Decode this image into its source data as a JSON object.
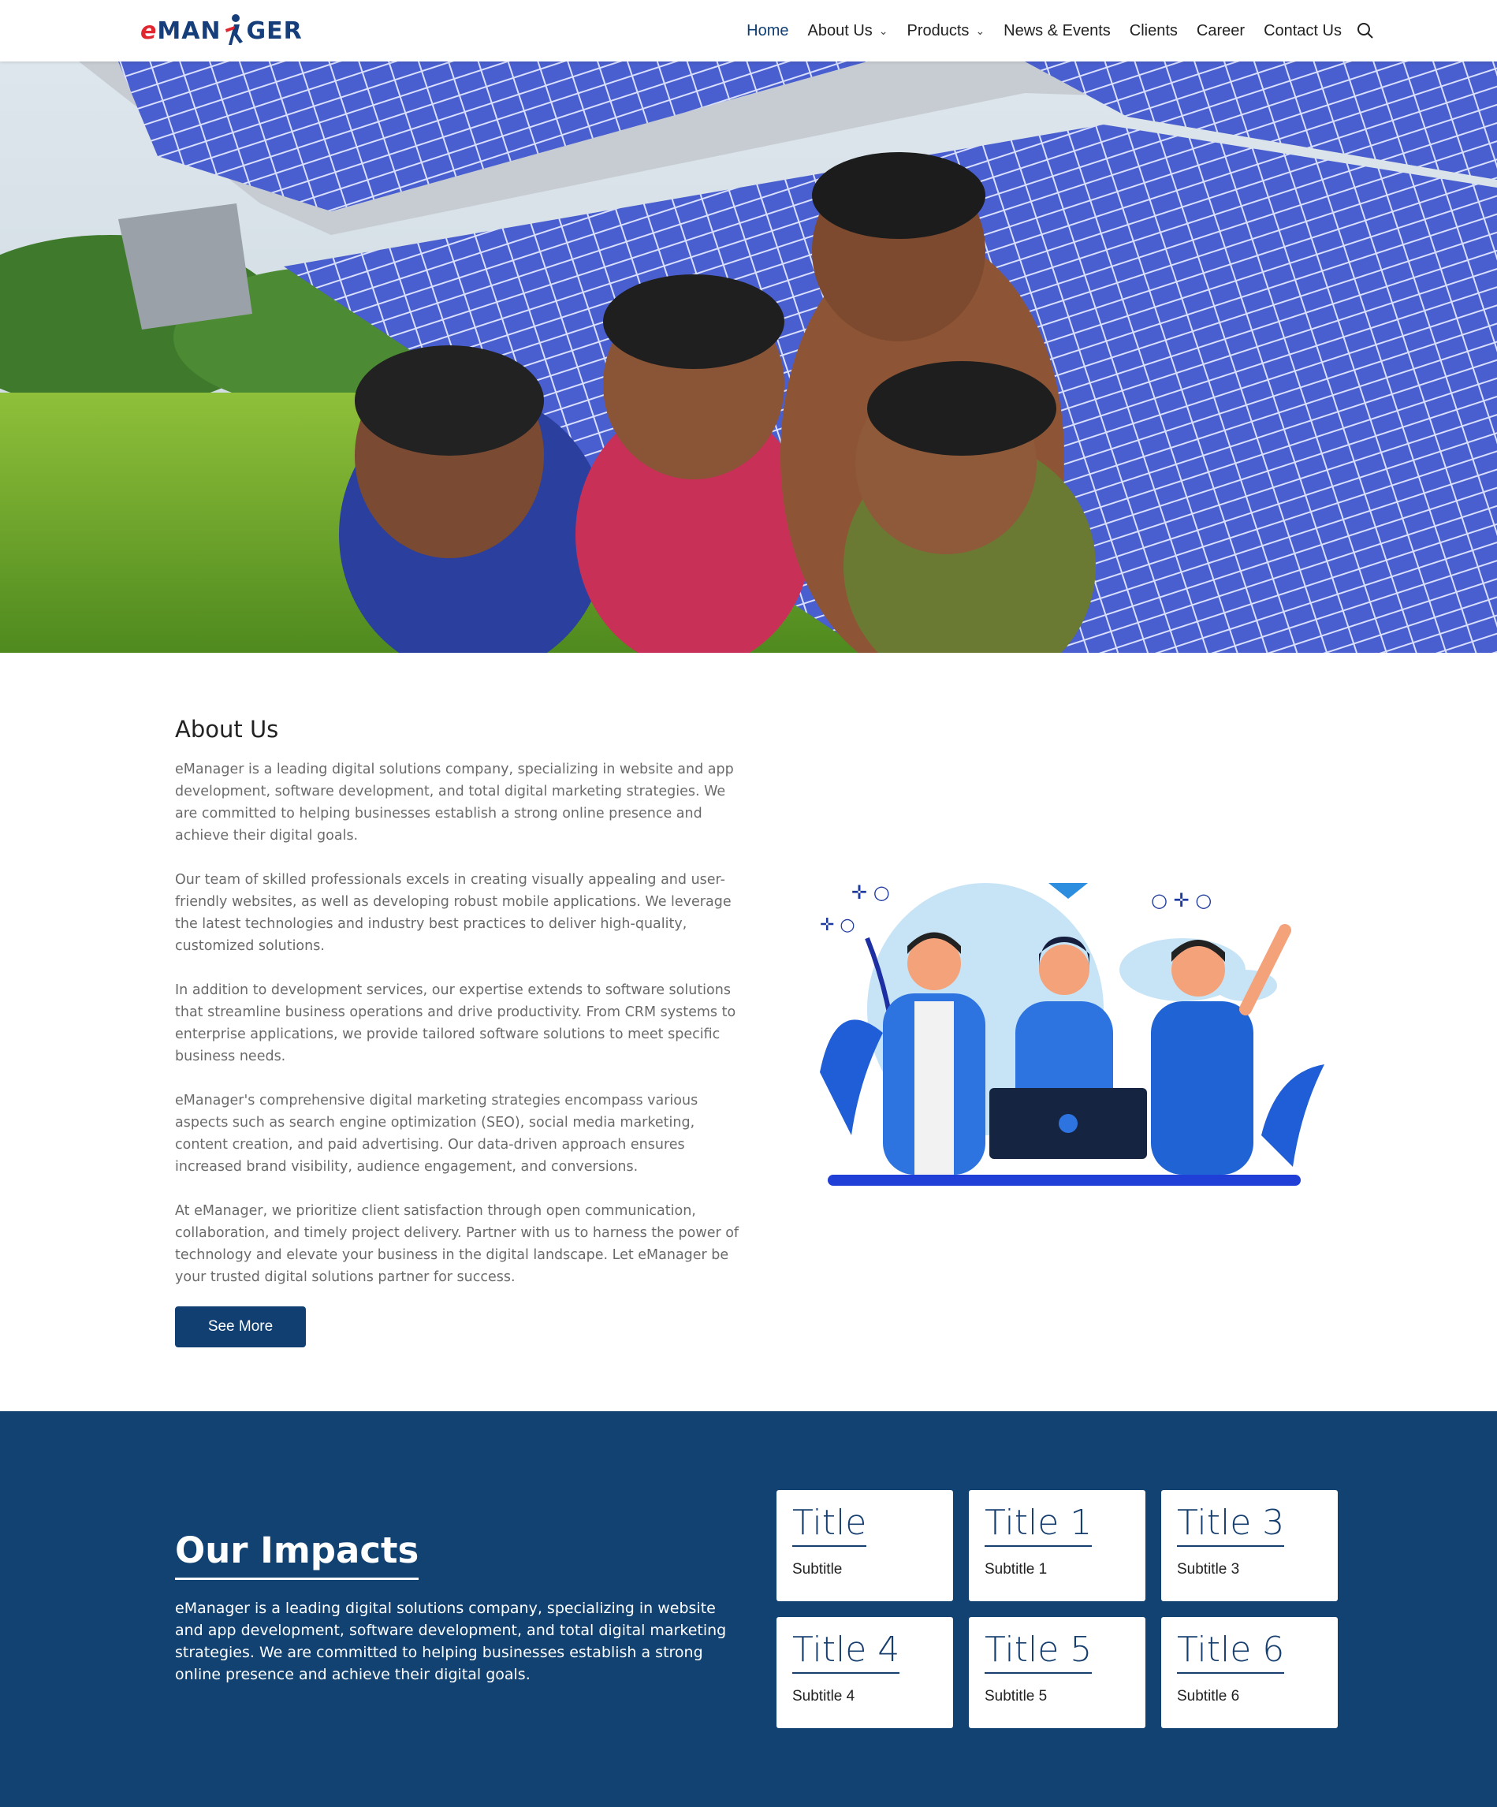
{
  "header": {
    "logo_text": "eMANAGER",
    "nav": [
      {
        "label": "Home",
        "active": true,
        "dropdown": false
      },
      {
        "label": "About Us",
        "active": false,
        "dropdown": true
      },
      {
        "label": "Products",
        "active": false,
        "dropdown": true
      },
      {
        "label": "News & Events",
        "active": false,
        "dropdown": false
      },
      {
        "label": "Clients",
        "active": false,
        "dropdown": false
      },
      {
        "label": "Career",
        "active": false,
        "dropdown": false
      },
      {
        "label": "Contact Us",
        "active": false,
        "dropdown": false
      }
    ],
    "search_icon": "search-icon"
  },
  "about": {
    "title": "About Us",
    "paragraphs": [
      "eManager is a leading digital solutions company, specializing in website and app development, software development, and total digital marketing strategies. We are committed to helping businesses establish a strong online presence and achieve their digital goals.",
      "Our team of skilled professionals excels in creating visually appealing and user-friendly websites, as well as developing robust mobile applications. We leverage the latest technologies and industry best practices to deliver high-quality, customized solutions.",
      "In addition to development services, our expertise extends to software solutions that streamline business operations and drive productivity. From CRM systems to enterprise applications, we provide tailored software solutions to meet specific business needs.",
      "eManager's comprehensive digital marketing strategies encompass various aspects such as search engine optimization (SEO), social media marketing, content creation, and paid advertising. Our data-driven approach ensures increased brand visibility, audience engagement, and conversions.",
      "At eManager, we prioritize client satisfaction through open communication, collaboration, and timely project delivery. Partner with us to harness the power of technology and elevate your business in the digital landscape. Let eManager be your trusted digital solutions partner for success."
    ],
    "button": "See More"
  },
  "impacts": {
    "title": "Our Impacts",
    "body": "eManager is a leading digital solutions company, specializing in website and app development, software development, and total digital marketing strategies. We are committed to helping businesses establish a strong online presence and achieve their digital goals.",
    "cards": [
      {
        "title": "Title",
        "subtitle": "Subtitle"
      },
      {
        "title": "Title 1",
        "subtitle": "Subtitle 1"
      },
      {
        "title": "Title 3",
        "subtitle": "Subtitle 3"
      },
      {
        "title": "Title 4",
        "subtitle": "Subtitle 4"
      },
      {
        "title": "Title 5",
        "subtitle": "Subtitle 5"
      },
      {
        "title": "Title 6",
        "subtitle": "Subtitle 6"
      }
    ]
  },
  "colors": {
    "brand_navy": "#114272",
    "logo_red": "#e0262f",
    "nav_active": "#0f3e73"
  }
}
